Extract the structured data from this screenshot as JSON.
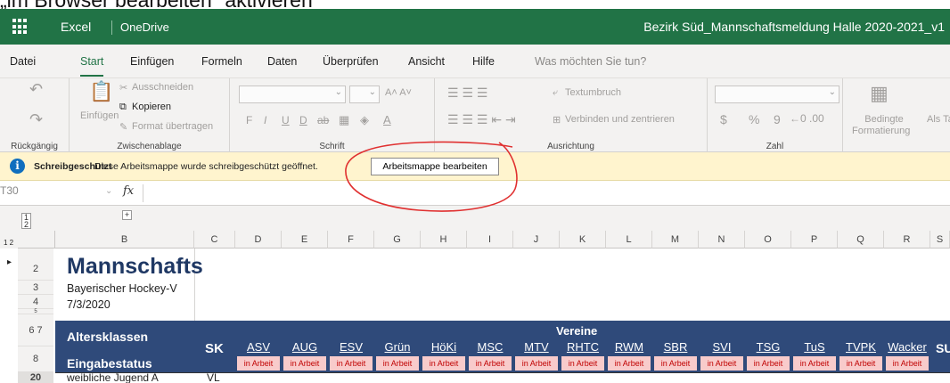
{
  "caption": "„im Browser bearbeiten\" aktivieren",
  "titlebar": {
    "app": "Excel",
    "service": "OneDrive",
    "filename": "Bezirk Süd_Mannschaftsmeldung Halle 2020-2021_v1"
  },
  "menu": [
    "Datei",
    "Start",
    "Einfügen",
    "Formeln",
    "Daten",
    "Überprüfen",
    "Ansicht",
    "Hilfe"
  ],
  "menu_hint": "Was möchten Sie tun?",
  "ribbon": {
    "undo_group": "Rückgängig",
    "paste": "Einfügen",
    "cut": "Ausschneiden",
    "copy": "Kopieren",
    "format_painter": "Format übertragen",
    "clipboard_group": "Zwischenablage",
    "font_group": "Schrift",
    "wrap": "Textumbruch",
    "merge": "Verbinden und zentrieren",
    "align_group": "Ausrichtung",
    "number_group": "Zahl",
    "cond_format_1": "Bedingte",
    "cond_format_2": "Formatierung",
    "as_table": "Als Ta",
    "font_buttons": [
      "F",
      "I",
      "U",
      "D",
      "ab"
    ],
    "number_buttons": [
      "$",
      "%",
      "9"
    ]
  },
  "message": {
    "bold": "Schreibgeschützt",
    "text": "Diese Arbeitsmappe wurde schreibgeschützt geöffnet.",
    "button": "Arbeitsmappe bearbeiten"
  },
  "formula": {
    "namebox": "T30",
    "fx": "fx"
  },
  "columns": [
    "B",
    "C",
    "D",
    "E",
    "F",
    "G",
    "H",
    "I",
    "J",
    "K",
    "L",
    "M",
    "N",
    "O",
    "P",
    "Q",
    "R",
    "S"
  ],
  "rows": [
    "2",
    "3",
    "4",
    "5",
    "6",
    "7",
    "8",
    "20"
  ],
  "outline_levels": [
    "1",
    "2"
  ],
  "cells": {
    "title": "Mannschafts",
    "org": "Bayerischer Hockey-V",
    "date": "7/3/2020",
    "altersklassen": "Altersklassen",
    "eingabestatus": "Eingabestatus",
    "sk": "SK",
    "vereine": "Vereine",
    "sum": "SU",
    "row20_b": "weibliche Jugend A",
    "row20_c": "VL"
  },
  "clubs": [
    "ASV",
    "AUG",
    "ESV",
    "Grün",
    "HöKi",
    "MSC",
    "MTV",
    "RHTC",
    "RWM",
    "SBR",
    "SVI",
    "TSG",
    "TuS",
    "TVPK",
    "Wacker"
  ],
  "status_label": "in Arbeit",
  "colors": {
    "excel_green": "#217346",
    "band_blue": "#2f4a7a",
    "status_pink": "#f8cbcb",
    "annotation_red": "#e03030"
  }
}
